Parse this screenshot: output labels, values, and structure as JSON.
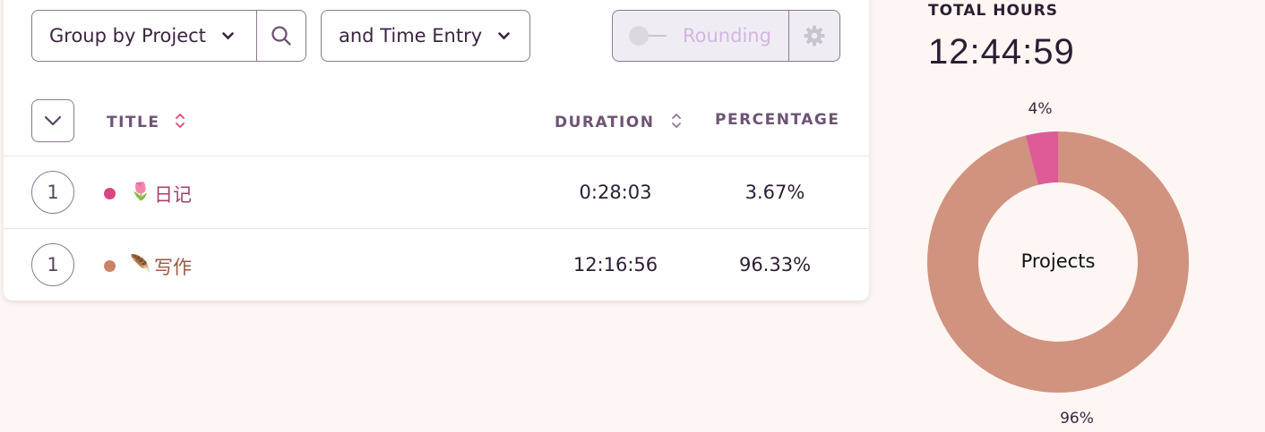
{
  "toolbar": {
    "group_label": "Group by Project",
    "entry_label": "and Time Entry",
    "rounding_label": "Rounding"
  },
  "table": {
    "headers": {
      "title": "TITLE",
      "duration": "DURATION",
      "percentage": "PERCENTAGE"
    },
    "rows": [
      {
        "count": "1",
        "icon": "tulip-emoji",
        "icon_char": "🌷",
        "name": "日记",
        "color": "#d9467f",
        "name_color": "#a4436c",
        "duration": "0:28:03",
        "percentage": "3.67%"
      },
      {
        "count": "1",
        "icon": "feather-emoji",
        "icon_char": "🪶",
        "name": "写作",
        "color": "#c98366",
        "name_color": "#9a5a44",
        "duration": "12:16:56",
        "percentage": "96.33%"
      }
    ]
  },
  "summary": {
    "total_label": "TOTAL HOURS",
    "total_value": "12:44:59"
  },
  "chart_data": {
    "type": "pie",
    "title": "Projects",
    "slices": [
      {
        "label": "写作",
        "value": 96,
        "color": "#d0937f"
      },
      {
        "label": "日记",
        "value": 4,
        "color": "#de5b97"
      }
    ],
    "data_labels": [
      "96%",
      "4%"
    ]
  },
  "colors": {
    "accent": "#d9467f",
    "border": "#8c7890",
    "background": "#fdf6f3"
  }
}
